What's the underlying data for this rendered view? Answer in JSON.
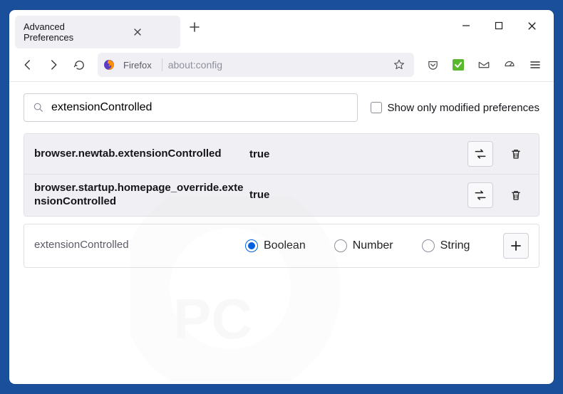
{
  "window": {
    "tab_title": "Advanced Preferences"
  },
  "urlbar": {
    "brand": "Firefox",
    "url": "about:config"
  },
  "config": {
    "search_value": "extensionControlled",
    "show_only_modified_label": "Show only modified preferences",
    "rows": [
      {
        "name": "browser.newtab.extensionControlled",
        "value": "true"
      },
      {
        "name": "browser.startup.homepage_override.extensionControlled",
        "value": "true"
      }
    ],
    "add": {
      "name": "extensionControlled",
      "types": {
        "boolean": "Boolean",
        "number": "Number",
        "string": "String"
      }
    }
  }
}
